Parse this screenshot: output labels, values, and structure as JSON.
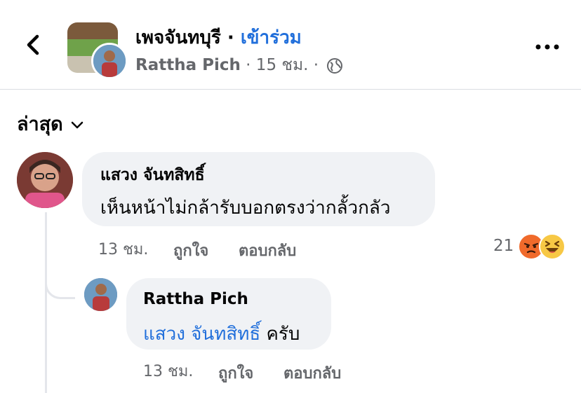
{
  "header": {
    "back_icon": "chevron-left-icon",
    "group_name": "เพจจันทบุรี",
    "separator": " · ",
    "join_label": "เข้าร่วม",
    "poster_name": "Rattha Pich",
    "post_time": " · 15 ชม. · ",
    "privacy_icon": "globe-icon",
    "more_icon": "more-horizontal-icon"
  },
  "sort": {
    "label": "ล่าสุด",
    "icon": "chevron-down-icon"
  },
  "comments": [
    {
      "author": "แสวง จันทสิทธิ์",
      "text": "เห็นหน้าไม่กล้ารับบอกตรงว่ากลั้วกลัว",
      "time": "13 ชม.",
      "like_label": "ถูกใจ",
      "reply_label": "ตอบกลับ",
      "reaction_count": "21",
      "reactions": [
        "angry-reaction-icon",
        "haha-reaction-icon"
      ]
    }
  ],
  "replies": [
    {
      "author": "Rattha Pich",
      "mention": "แสวง จันทสิทธิ์",
      "text": " ครับ",
      "time": "13 ชม.",
      "like_label": "ถูกใจ",
      "reply_label": "ตอบกลับ"
    }
  ],
  "colors": {
    "accent": "#216fdb",
    "secondary_text": "#65676b",
    "bubble": "#f0f2f5"
  }
}
